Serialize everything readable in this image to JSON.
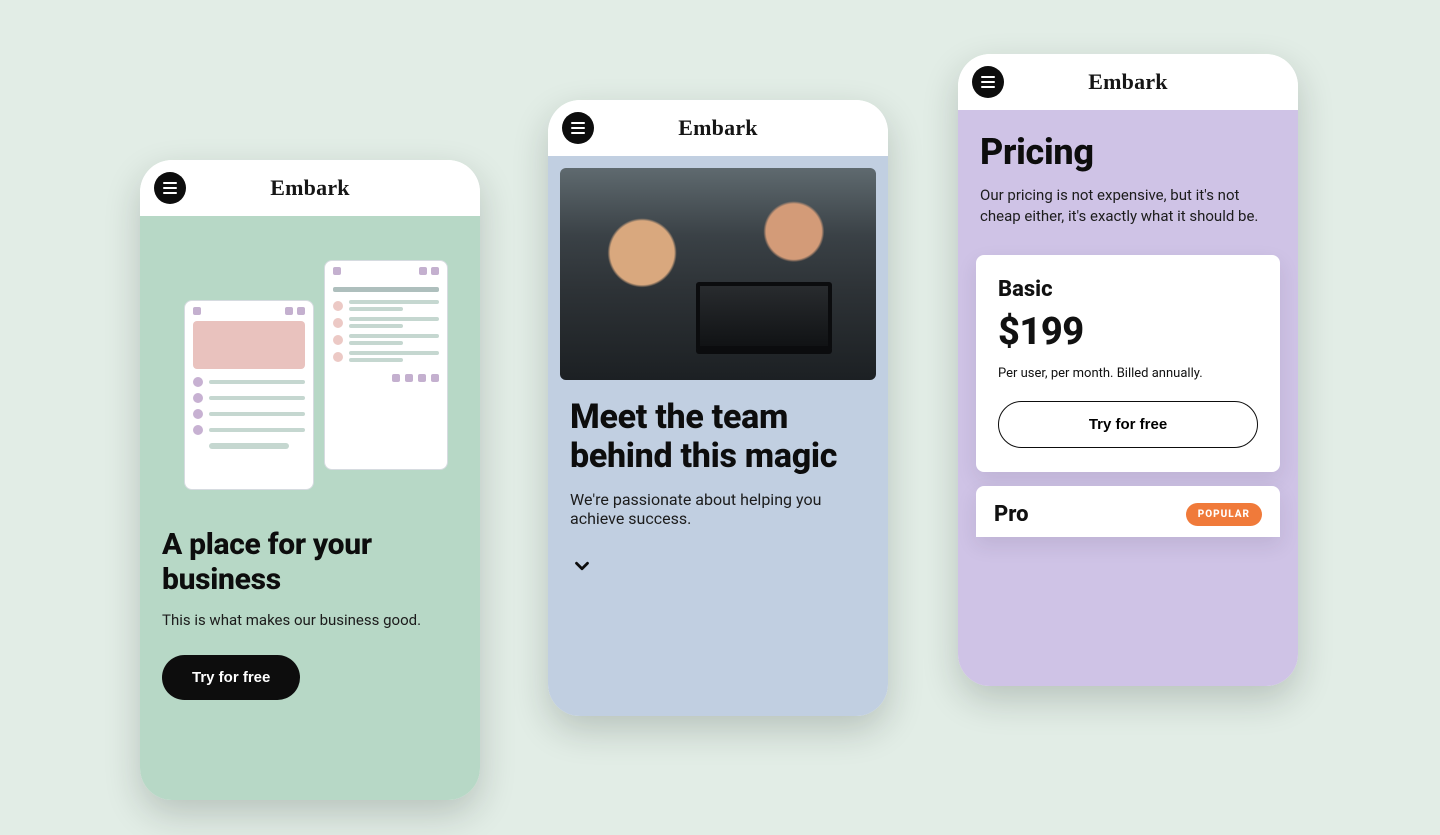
{
  "brand": "Embark",
  "phone1": {
    "heading": "A place for your business",
    "sub": "This is what makes our business good.",
    "cta": "Try for free"
  },
  "phone2": {
    "heading": "Meet the team behind this magic",
    "sub": "We're passionate about helping you achieve success."
  },
  "phone3": {
    "heading": "Pricing",
    "sub": "Our pricing is not expensive, but it's not cheap either, it's exactly what it should be.",
    "plan1": {
      "name": "Basic",
      "price": "$199",
      "meta": "Per user, per month. Billed annually.",
      "cta": "Try for free"
    },
    "plan2": {
      "name": "Pro",
      "badge": "POPULAR"
    }
  }
}
